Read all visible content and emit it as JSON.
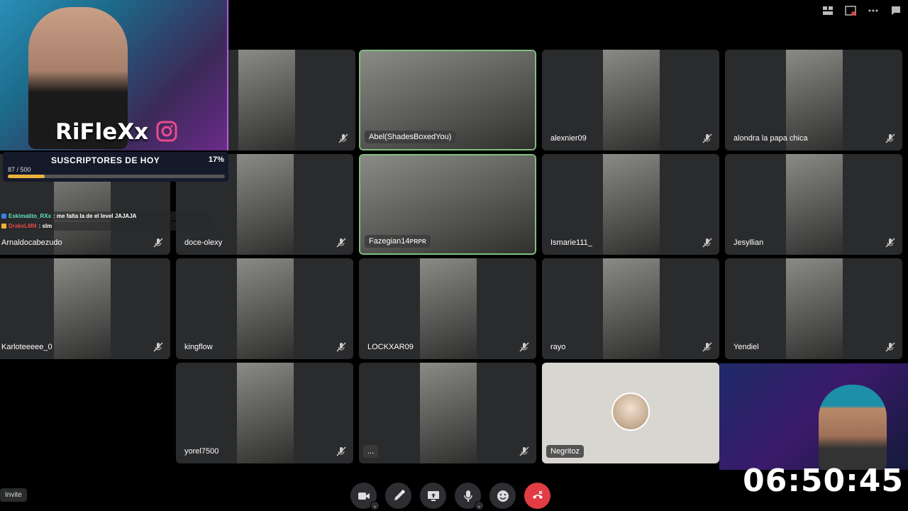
{
  "toolbar": {
    "icons": [
      "grid-layout-icon",
      "popout-icon",
      "more-icon",
      "chat-icon"
    ]
  },
  "streamer": {
    "brand": "RiFleXx",
    "subs_title": "SUSCRIPTORES DE HOY",
    "subs_count": "87 / 500",
    "subs_percent": "17%",
    "subs_fraction": 0.17
  },
  "chat": [
    {
      "user": "Eskimalito_RXx",
      "msg": ": me falta la de el level JAJAJA"
    },
    {
      "user": "DrakeLMN",
      "msg": ": slm"
    }
  ],
  "participants": [
    {
      "name": "",
      "muted": true
    },
    {
      "name": "Abel(ShadesBoxedYou)",
      "muted": false,
      "speaking": true
    },
    {
      "name": "alexnier09",
      "muted": true
    },
    {
      "name": "alondra la papa chica",
      "muted": true
    },
    {
      "name": "Arnaldocabezudo",
      "muted": true
    },
    {
      "name": "doce-olexy",
      "muted": true
    },
    {
      "name": "Fazegian14ᴘʀᴘʀ",
      "muted": false,
      "speaking": true
    },
    {
      "name": "Ismarie111_",
      "muted": true
    },
    {
      "name": "Jesyllian",
      "muted": true
    },
    {
      "name": "Karloteeeee_0",
      "muted": true
    },
    {
      "name": "kingflow",
      "muted": true
    },
    {
      "name": "LOCKXAR09",
      "muted": true
    },
    {
      "name": "rayo",
      "muted": true
    },
    {
      "name": "Yendiel",
      "muted": true
    },
    {
      "name": "yorel7500",
      "muted": true
    },
    {
      "name": "...",
      "muted": true
    },
    {
      "name": "Negritoz",
      "muted": false
    }
  ],
  "timer": "06:50:45",
  "controls": {
    "invite": "Invite",
    "buttons": [
      "camera-icon",
      "activity-rocket-icon",
      "screen-share-icon",
      "microphone-icon",
      "emoji-icon",
      "end-call-icon"
    ]
  }
}
